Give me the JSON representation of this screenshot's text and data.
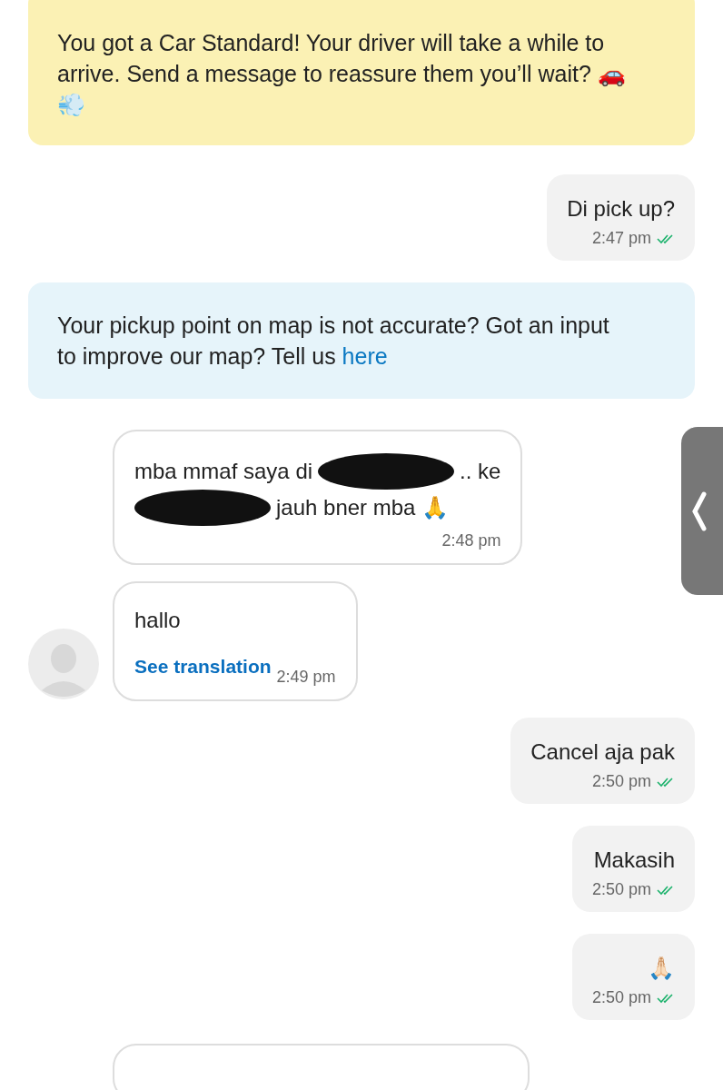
{
  "messages": [
    {
      "kind": "notice",
      "color": "#fbf1b4",
      "text": "You got a Car Standard! Your driver will take a while to arrive. Send a message to reassure them you’ll wait? 🚗💨"
    },
    {
      "kind": "outgoing",
      "text": "Di pick up?",
      "time": "2:47 pm",
      "read": true
    },
    {
      "kind": "notice",
      "color": "#e6f4fa",
      "text": "Your pickup point on map is not accurate? Got an input to improve our map? Tell us",
      "link": "here"
    },
    {
      "kind": "incoming",
      "avatar": false,
      "lines": [
        [
          {
            "kind": "text",
            "text": "mba mmaf saya di"
          },
          {
            "kind": "scribble"
          },
          {
            "kind": "text",
            "text": ".. ke"
          }
        ],
        [
          {
            "kind": "scribble"
          },
          {
            "kind": "text",
            "text": "jauh bner mba 🙏"
          }
        ]
      ],
      "time": "2:48 pm"
    },
    {
      "kind": "incoming",
      "avatar": true,
      "lines": [
        [
          {
            "kind": "text",
            "text": "hallo"
          }
        ]
      ],
      "translation": "See translation",
      "time": "2:49 pm"
    },
    {
      "kind": "outgoing",
      "text": "Cancel aja pak",
      "time": "2:50 pm",
      "read": true
    },
    {
      "kind": "outgoing",
      "text": "Makasih",
      "time": "2:50 pm",
      "read": true
    },
    {
      "kind": "outgoing",
      "text": "🙏🏻",
      "time": "2:50 pm",
      "read": true
    },
    {
      "kind": "incoming_cut"
    }
  ]
}
